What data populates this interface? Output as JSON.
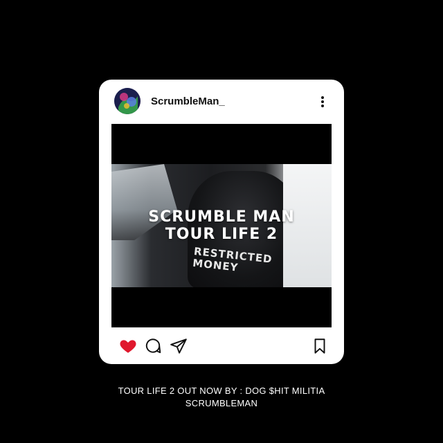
{
  "post": {
    "username": "ScrumbleMan_",
    "media_title_line1": "SCRUMBLE MAN",
    "media_title_line2": "TOUR LIFE 2",
    "shirt_text": "RESTRICTED MONEY",
    "liked": true
  },
  "icons": {
    "avatar": "avatar-image",
    "menu": "more-vertical-icon",
    "like": "heart-icon",
    "comment": "comment-icon",
    "share": "send-icon",
    "save": "bookmark-icon"
  },
  "colors": {
    "background": "#000000",
    "card": "#ffffff",
    "like_active": "#e0182d"
  },
  "caption": {
    "line1": "TOUR LIFE 2 OUT NOW BY : DOG $HIT MILITIA",
    "line2": "SCRUMBLEMAN"
  }
}
